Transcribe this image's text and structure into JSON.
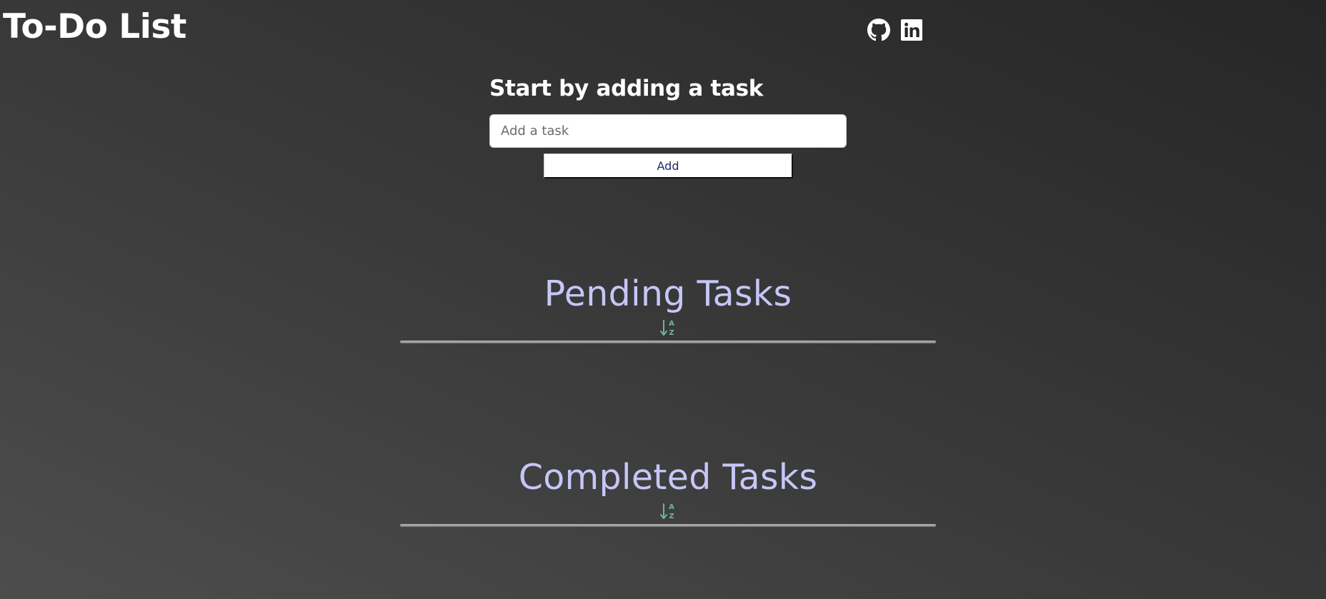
{
  "header": {
    "title": "To-Do List",
    "social_links": [
      {
        "name": "github",
        "icon": "github-icon"
      },
      {
        "name": "linkedin",
        "icon": "linkedin-icon"
      }
    ]
  },
  "add_task": {
    "heading": "Start by adding a task",
    "input_placeholder": "Add a task",
    "input_value": "",
    "button_label": "Add"
  },
  "pending": {
    "title": "Pending Tasks",
    "sort_icon": "sort-alpha-icon",
    "tasks": []
  },
  "completed": {
    "title": "Completed Tasks",
    "sort_icon": "sort-alpha-icon",
    "tasks": []
  },
  "colors": {
    "section_title": "#c6c6f8",
    "sort_icon": "#6fb4a2",
    "button_text": "#1f2a6b",
    "divider": "#9d9d9d"
  }
}
